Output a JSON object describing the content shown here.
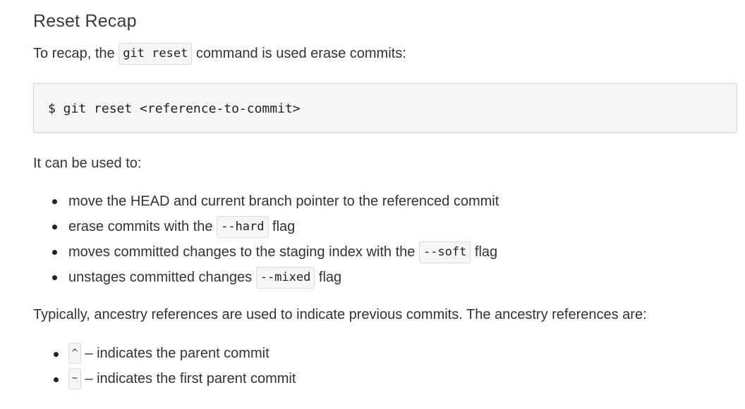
{
  "heading": "Reset Recap",
  "intro": {
    "before": "To recap, the ",
    "code": "git reset",
    "after": " command is used erase commits:"
  },
  "code_block": "$ git reset <reference-to-commit>",
  "uses_intro": "It can be used to:",
  "uses": [
    {
      "before": "move the HEAD and current branch pointer to the referenced commit",
      "code": "",
      "after": ""
    },
    {
      "before": "erase commits with the ",
      "code": "--hard",
      "after": " flag"
    },
    {
      "before": "moves committed changes to the staging index with the ",
      "code": "--soft",
      "after": " flag"
    },
    {
      "before": "unstages committed changes ",
      "code": "--mixed",
      "after": " flag"
    }
  ],
  "ancestry_intro": "Typically, ancestry references are used to indicate previous commits. The ancestry references are:",
  "ancestry": [
    {
      "code": "^",
      "text": " – indicates the parent commit"
    },
    {
      "code": "~",
      "text": " – indicates the first parent commit"
    }
  ]
}
